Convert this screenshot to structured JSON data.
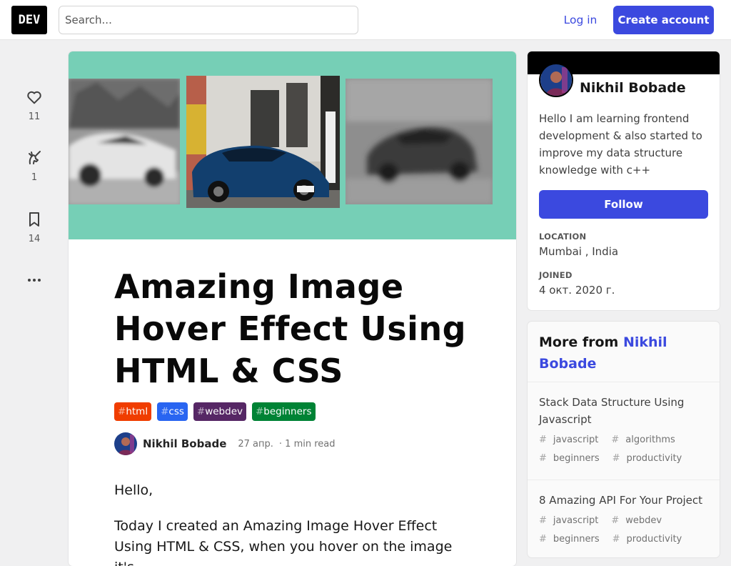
{
  "header": {
    "logo": "DEV",
    "search_placeholder": "Search...",
    "login": "Log in",
    "create_account": "Create account"
  },
  "reactions": {
    "hearts": "11",
    "unicorns": "1",
    "bookmarks": "14"
  },
  "article": {
    "title": "Amazing Image Hover Effect Using HTML & CSS",
    "tags": [
      {
        "name": "html",
        "color": "#f03d00"
      },
      {
        "name": "css",
        "color": "#2965f1"
      },
      {
        "name": "webdev",
        "color": "#562765"
      },
      {
        "name": "beginners",
        "color": "#008335"
      }
    ],
    "author": "Nikhil Bobade",
    "date": "27 апр.",
    "read_time": "1 min read",
    "paragraphs": [
      "Hello,",
      "Today I created an Amazing Image Hover Effect Using HTML & CSS, when you hover on the image it's"
    ]
  },
  "profile": {
    "name": "Nikhil Bobade",
    "bio": "Hello I am learning frontend development & also started to improve my data structure knowledge with c++",
    "follow": "Follow",
    "location_label": "LOCATION",
    "location": "Mumbai , India",
    "joined_label": "JOINED",
    "joined": "4 окт. 2020 г."
  },
  "more_from": {
    "heading": "More from",
    "author": "Nikhil Bobade",
    "posts": [
      {
        "title": "Stack Data Structure Using Javascript",
        "tags": [
          "javascript",
          "algorithms",
          "beginners",
          "productivity"
        ]
      },
      {
        "title": "8 Amazing API For Your Project",
        "tags": [
          "javascript",
          "webdev",
          "beginners",
          "productivity"
        ]
      }
    ]
  },
  "colors": {
    "accent": "#3b49df",
    "cover_bg": "#76cfb6"
  }
}
